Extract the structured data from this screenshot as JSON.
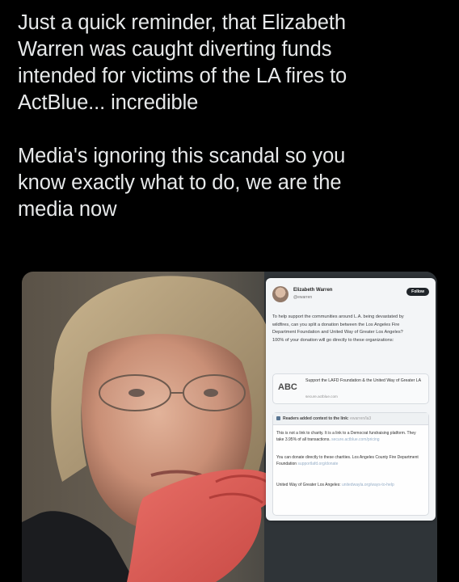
{
  "post": {
    "paragraph_1": "Just a quick reminder, that Elizabeth\nWarren was caught diverting funds\nintended for victims of the LA fires to\nActBlue... incredible",
    "paragraph_2": "Media's ignoring this scandal so you\nknow exactly what to do, we are the\nmedia now"
  },
  "embed": {
    "name": "Elizabeth Warren",
    "handle": "@ewarren",
    "follow_label": "Follow",
    "body": "To help support the communities around L.A. being devastated by wildfires, can you split a donation between the Los Angeles Fire Department Foundation and United Way of Greater Los Angeles? 100% of your donation will go directly to these organizations:",
    "card_logo": "ABC",
    "card_title": "Support the LAFD Foundation & the United Way of Greater LA",
    "card_url": "secure.actblue.com",
    "notes_header": "Readers added context to the link:",
    "notes_header_link": "ewarren/la3",
    "note_1": "This is not a link to charity. It is a link to a Democrat fundraising platform. They take 3.95% of all transactions.",
    "note_1_link": "secure.actblue.com/pricing",
    "note_2": "You can donate directly to these charities. Los Angeles County Fire Department Foundation",
    "note_2_link": "supportlafd.org/donate",
    "note_3": "United Way of Greater Los Angeles:",
    "note_3_link": "unitedwayla.org/ways-to-help"
  },
  "colors": {
    "background": "#000000",
    "text": "#e7e9ea",
    "embed_bg": "#f4f6f8"
  }
}
